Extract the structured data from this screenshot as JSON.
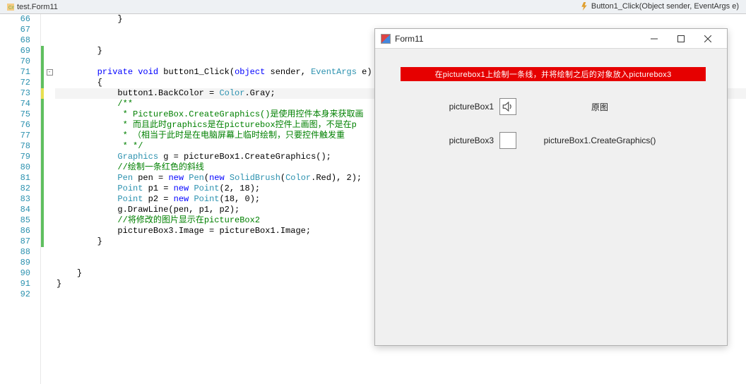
{
  "tab": {
    "name": "test.Form11"
  },
  "top_method": "Button1_Click(Object sender, EventArgs e)",
  "gutter": {
    "start": 66,
    "end": 92
  },
  "code": {
    "lines": [
      {
        "n": 66,
        "indent": 12,
        "parts": [
          {
            "t": "txt",
            "v": "}"
          }
        ],
        "mark": ""
      },
      {
        "n": 67,
        "indent": 0,
        "parts": [],
        "mark": ""
      },
      {
        "n": 68,
        "indent": 0,
        "parts": [],
        "mark": ""
      },
      {
        "n": 69,
        "indent": 8,
        "parts": [
          {
            "t": "txt",
            "v": "}"
          }
        ],
        "mark": "green"
      },
      {
        "n": 70,
        "indent": 0,
        "parts": [],
        "mark": "green"
      },
      {
        "n": 71,
        "indent": 8,
        "fold": true,
        "parts": [
          {
            "t": "kw",
            "v": "private"
          },
          {
            "t": "txt",
            "v": " "
          },
          {
            "t": "kw",
            "v": "void"
          },
          {
            "t": "txt",
            "v": " button1_Click("
          },
          {
            "t": "kw",
            "v": "object"
          },
          {
            "t": "txt",
            "v": " sender, "
          },
          {
            "t": "cls",
            "v": "EventArgs"
          },
          {
            "t": "txt",
            "v": " e)"
          }
        ],
        "mark": "green"
      },
      {
        "n": 72,
        "indent": 8,
        "parts": [
          {
            "t": "txt",
            "v": "{"
          }
        ],
        "mark": "green"
      },
      {
        "n": 73,
        "indent": 12,
        "current": true,
        "parts": [
          {
            "t": "txt",
            "v": "button1.BackColor = "
          },
          {
            "t": "cls",
            "v": "Color"
          },
          {
            "t": "txt",
            "v": ".Gray;"
          }
        ],
        "mark": "yellow"
      },
      {
        "n": 74,
        "indent": 12,
        "parts": [
          {
            "t": "str-comment",
            "v": "/**"
          }
        ],
        "mark": "green"
      },
      {
        "n": 75,
        "indent": 12,
        "parts": [
          {
            "t": "str-comment",
            "v": " * PictureBox.CreateGraphics()是使用控件本身来获取画"
          }
        ],
        "mark": "green"
      },
      {
        "n": 76,
        "indent": 12,
        "parts": [
          {
            "t": "str-comment",
            "v": " * 而且此时graphics是在picturebox控件上画图，不是在p"
          }
        ],
        "mark": "green"
      },
      {
        "n": 77,
        "indent": 12,
        "parts": [
          {
            "t": "str-comment",
            "v": " * （相当于此时是在电脑屏幕上临时绘制，只要控件触发重"
          }
        ],
        "mark": "green"
      },
      {
        "n": 78,
        "indent": 12,
        "parts": [
          {
            "t": "str-comment",
            "v": " * */"
          }
        ],
        "mark": "green"
      },
      {
        "n": 79,
        "indent": 12,
        "parts": [
          {
            "t": "cls",
            "v": "Graphics"
          },
          {
            "t": "txt",
            "v": " g = pictureBox1.CreateGraphics();"
          }
        ],
        "mark": "green"
      },
      {
        "n": 80,
        "indent": 12,
        "parts": [
          {
            "t": "str-comment",
            "v": "//绘制一条红色的斜线"
          }
        ],
        "mark": "green"
      },
      {
        "n": 81,
        "indent": 12,
        "parts": [
          {
            "t": "cls",
            "v": "Pen"
          },
          {
            "t": "txt",
            "v": " pen = "
          },
          {
            "t": "kw",
            "v": "new"
          },
          {
            "t": "txt",
            "v": " "
          },
          {
            "t": "cls",
            "v": "Pen"
          },
          {
            "t": "txt",
            "v": "("
          },
          {
            "t": "kw",
            "v": "new"
          },
          {
            "t": "txt",
            "v": " "
          },
          {
            "t": "cls",
            "v": "SolidBrush"
          },
          {
            "t": "txt",
            "v": "("
          },
          {
            "t": "cls",
            "v": "Color"
          },
          {
            "t": "txt",
            "v": ".Red), 2);"
          }
        ],
        "mark": "green"
      },
      {
        "n": 82,
        "indent": 12,
        "parts": [
          {
            "t": "cls",
            "v": "Point"
          },
          {
            "t": "txt",
            "v": " p1 = "
          },
          {
            "t": "kw",
            "v": "new"
          },
          {
            "t": "txt",
            "v": " "
          },
          {
            "t": "cls",
            "v": "Point"
          },
          {
            "t": "txt",
            "v": "(2, 18);"
          }
        ],
        "mark": "green"
      },
      {
        "n": 83,
        "indent": 12,
        "parts": [
          {
            "t": "cls",
            "v": "Point"
          },
          {
            "t": "txt",
            "v": " p2 = "
          },
          {
            "t": "kw",
            "v": "new"
          },
          {
            "t": "txt",
            "v": " "
          },
          {
            "t": "cls",
            "v": "Point"
          },
          {
            "t": "txt",
            "v": "(18, 0);"
          }
        ],
        "mark": "green"
      },
      {
        "n": 84,
        "indent": 12,
        "parts": [
          {
            "t": "txt",
            "v": "g.DrawLine(pen, p1, p2);"
          }
        ],
        "mark": "green"
      },
      {
        "n": 85,
        "indent": 12,
        "parts": [
          {
            "t": "str-comment",
            "v": "//将修改的图片显示在pictureBox2"
          }
        ],
        "mark": "green"
      },
      {
        "n": 86,
        "indent": 12,
        "parts": [
          {
            "t": "txt",
            "v": "pictureBox3.Image = pictureBox1.Image;"
          }
        ],
        "mark": "green"
      },
      {
        "n": 87,
        "indent": 8,
        "parts": [
          {
            "t": "txt",
            "v": "}"
          }
        ],
        "mark": "green"
      },
      {
        "n": 88,
        "indent": 0,
        "parts": [],
        "mark": ""
      },
      {
        "n": 89,
        "indent": 0,
        "parts": [],
        "mark": ""
      },
      {
        "n": 90,
        "indent": 4,
        "parts": [
          {
            "t": "txt",
            "v": "}"
          }
        ],
        "mark": ""
      },
      {
        "n": 91,
        "indent": 0,
        "parts": [
          {
            "t": "txt",
            "v": "}"
          }
        ],
        "mark": ""
      },
      {
        "n": 92,
        "indent": 0,
        "parts": [],
        "mark": ""
      }
    ]
  },
  "winform": {
    "title": "Form11",
    "banner": "在picturebox1上绘制一条线，并将绘制之后的对象放入picturebox3",
    "row1": {
      "left": "pictureBox1",
      "right": "原图"
    },
    "row2": {
      "left": "pictureBox3",
      "right": "pictureBox1.CreateGraphics()"
    }
  }
}
